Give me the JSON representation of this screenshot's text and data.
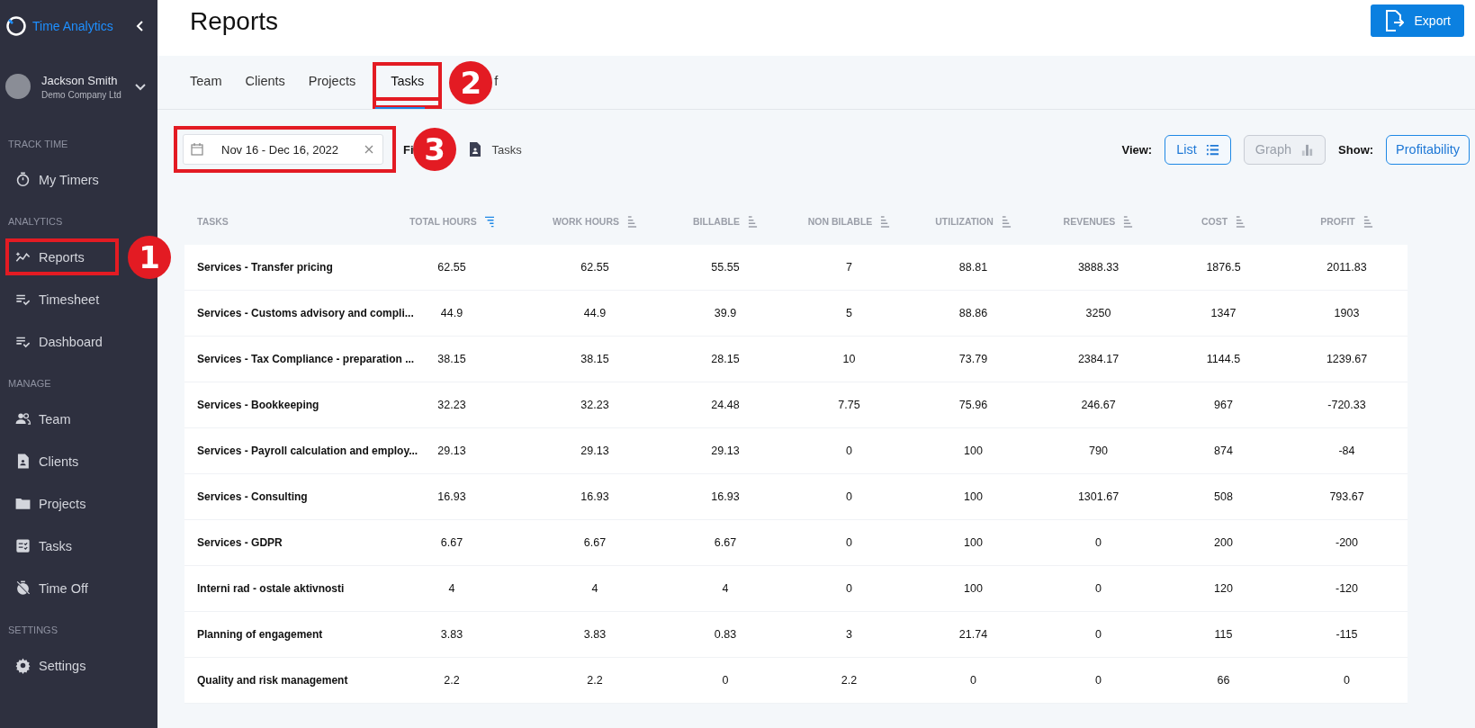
{
  "sidebar": {
    "logo_text": "Time Analytics",
    "user": {
      "name": "Jackson Smith",
      "company": "Demo Company Ltd"
    },
    "sections": [
      {
        "title": "TRACK TIME",
        "items": [
          {
            "label": "My Timers",
            "highlighted": false
          }
        ]
      },
      {
        "title": "ANALYTICS",
        "items": [
          {
            "label": "Reports",
            "highlighted": true,
            "badge": "1"
          },
          {
            "label": "Timesheet",
            "highlighted": false
          },
          {
            "label": "Dashboard",
            "highlighted": false
          }
        ]
      },
      {
        "title": "MANAGE",
        "items": [
          {
            "label": "Team",
            "highlighted": false
          },
          {
            "label": "Clients",
            "highlighted": false
          },
          {
            "label": "Projects",
            "highlighted": false
          },
          {
            "label": "Tasks",
            "highlighted": false
          },
          {
            "label": "Time Off",
            "highlighted": false
          }
        ]
      },
      {
        "title": "SETTINGS",
        "items": [
          {
            "label": "Settings",
            "highlighted": false
          }
        ]
      }
    ]
  },
  "header": {
    "title": "Reports",
    "export_button": "Export"
  },
  "tabs": [
    {
      "label": "Team",
      "selected": false,
      "highlighted": false
    },
    {
      "label": "Clients",
      "selected": false,
      "highlighted": false
    },
    {
      "label": "Projects",
      "selected": false,
      "highlighted": false
    },
    {
      "label": "Tasks",
      "selected": true,
      "highlighted": true,
      "badge": "2"
    },
    {
      "label": "f",
      "selected": false,
      "highlighted": false
    }
  ],
  "filters": {
    "date_range": {
      "value": "Nov 16 - Dec 16, 2022",
      "highlighted": true,
      "badge": "3"
    },
    "filter_label": "Fi",
    "filter_value": "Tasks",
    "view_label": "View:",
    "view_options": [
      {
        "label": "List",
        "selected": true
      },
      {
        "label": "Graph",
        "selected": false
      }
    ],
    "show_label": "Show:",
    "show_value": "Profitability"
  },
  "table": {
    "columns": [
      {
        "label": "TASKS"
      },
      {
        "label": "TOTAL HOURS",
        "sorted": true
      },
      {
        "label": "WORK HOURS",
        "sorted": false
      },
      {
        "label": "BILLABLE",
        "sorted": false
      },
      {
        "label": "NON BILABLE",
        "sorted": false
      },
      {
        "label": "UTILIZATION",
        "sorted": false
      },
      {
        "label": "REVENUES",
        "sorted": false
      },
      {
        "label": "COST",
        "sorted": false
      },
      {
        "label": "PROFIT",
        "sorted": false
      }
    ],
    "rows": [
      [
        "Services - Transfer pricing",
        "62.55",
        "62.55",
        "55.55",
        "7",
        "88.81",
        "3888.33",
        "1876.5",
        "2011.83"
      ],
      [
        "Services - Customs advisory and compli...",
        "44.9",
        "44.9",
        "39.9",
        "5",
        "88.86",
        "3250",
        "1347",
        "1903"
      ],
      [
        "Services - Tax Compliance - preparation ...",
        "38.15",
        "38.15",
        "28.15",
        "10",
        "73.79",
        "2384.17",
        "1144.5",
        "1239.67"
      ],
      [
        "Services - Bookkeeping",
        "32.23",
        "32.23",
        "24.48",
        "7.75",
        "75.96",
        "246.67",
        "967",
        "-720.33"
      ],
      [
        "Services - Payroll calculation and employ...",
        "29.13",
        "29.13",
        "29.13",
        "0",
        "100",
        "790",
        "874",
        "-84"
      ],
      [
        "Services - Consulting",
        "16.93",
        "16.93",
        "16.93",
        "0",
        "100",
        "1301.67",
        "508",
        "793.67"
      ],
      [
        "Services - GDPR",
        "6.67",
        "6.67",
        "6.67",
        "0",
        "100",
        "0",
        "200",
        "-200"
      ],
      [
        "Interni rad - ostale aktivnosti",
        "4",
        "4",
        "4",
        "0",
        "100",
        "0",
        "120",
        "-120"
      ],
      [
        "Planning of engagement",
        "3.83",
        "3.83",
        "0.83",
        "3",
        "21.74",
        "0",
        "115",
        "-115"
      ],
      [
        "Quality and risk management",
        "2.2",
        "2.2",
        "0",
        "2.2",
        "0",
        "0",
        "66",
        "0"
      ]
    ]
  }
}
